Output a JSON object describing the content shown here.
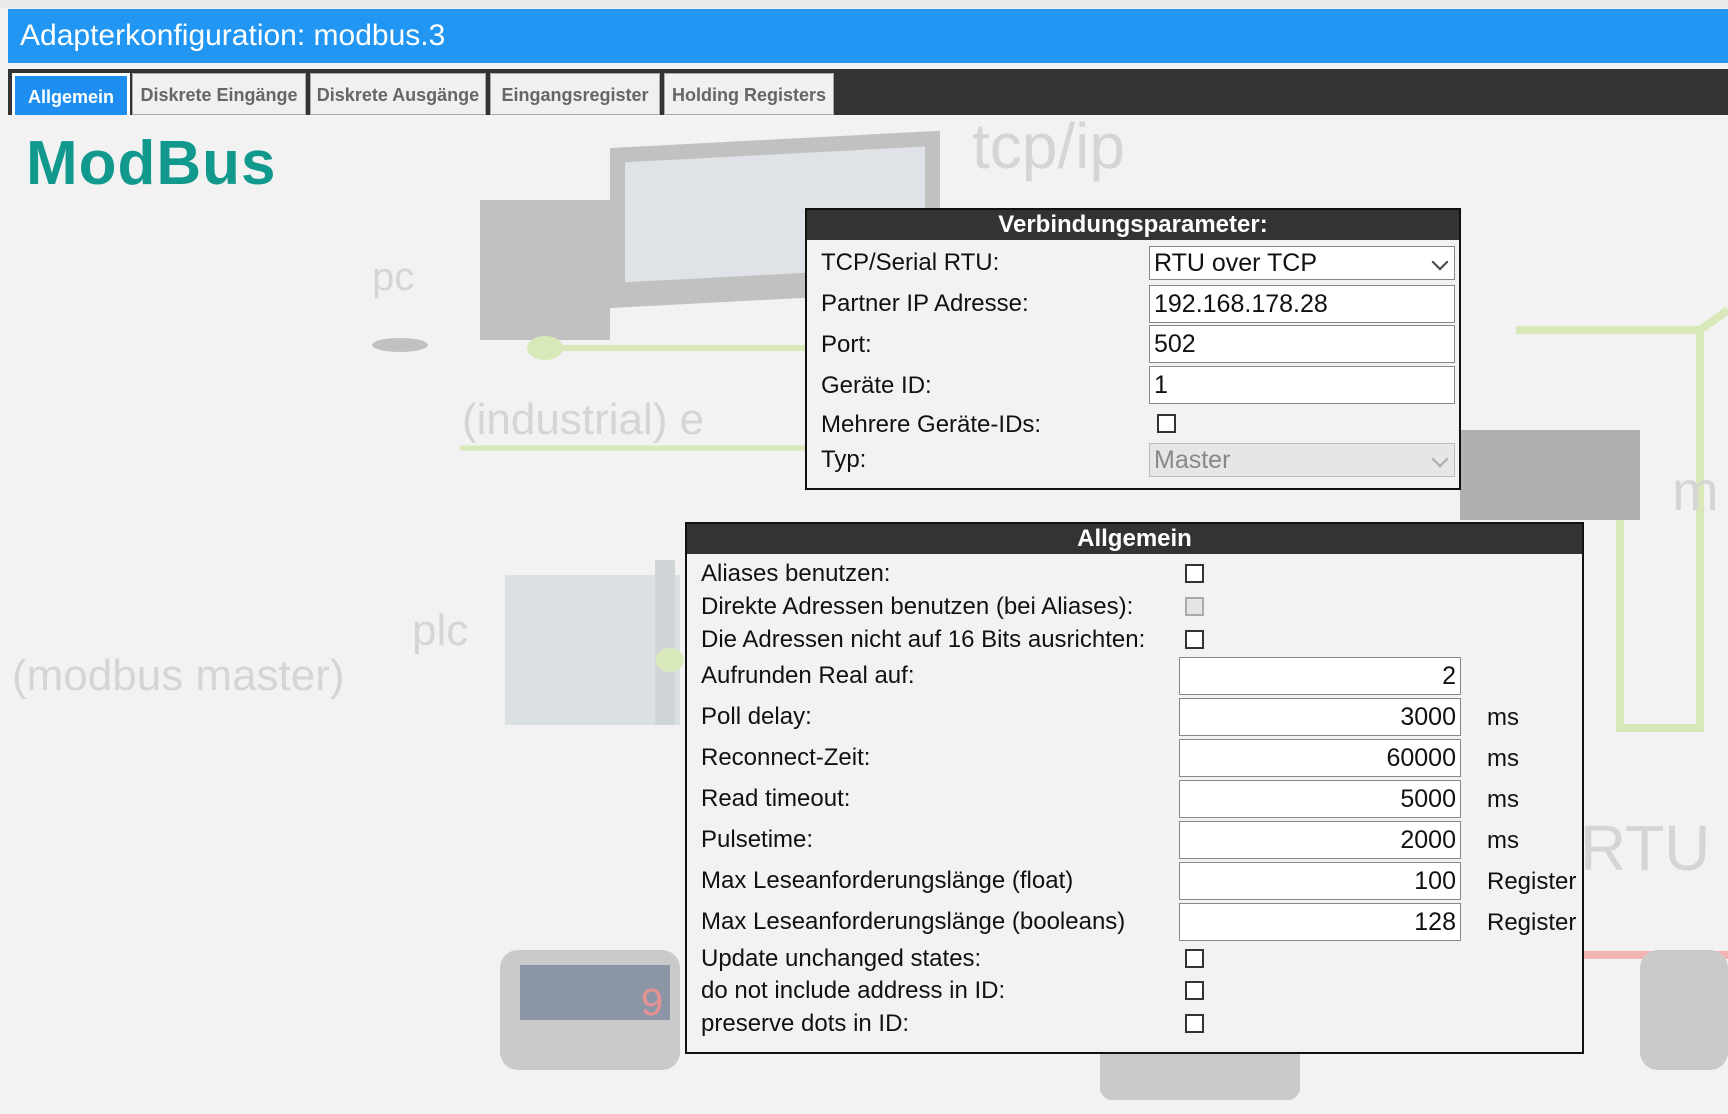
{
  "window": {
    "title": "Adapterkonfiguration: modbus.3"
  },
  "tabs": [
    {
      "label": "Allgemein",
      "active": true
    },
    {
      "label": "Diskrete Eingänge",
      "active": false
    },
    {
      "label": "Diskrete Ausgänge",
      "active": false
    },
    {
      "label": "Eingangsregister",
      "active": false
    },
    {
      "label": "Holding Registers",
      "active": false
    }
  ],
  "brand": "ModBus",
  "background": {
    "tcpip": "tcp/ip",
    "pc": "pc",
    "industrial": "(industrial) e",
    "plc": "plc",
    "modbus_master": "(modbus master)",
    "m": "m",
    "rtu": "RTU",
    "display_digit": "9",
    "colors": {
      "green": "#c5e08a",
      "red": "#f28080",
      "ghost": "#c8c8c8"
    }
  },
  "connection": {
    "title": "Verbindungsparameter:",
    "rows": [
      {
        "label": "TCP/Serial RTU:",
        "value": "RTU over TCP"
      },
      {
        "label": "Partner IP Adresse:",
        "value": "192.168.178.28"
      },
      {
        "label": "Port:",
        "value": "502"
      },
      {
        "label": "Geräte ID:",
        "value": "1"
      },
      {
        "label": "Mehrere Geräte-IDs:",
        "checked": false
      },
      {
        "label": "Typ:",
        "value": "Master",
        "disabled": true
      }
    ]
  },
  "general": {
    "title": "Allgemein",
    "rows": [
      {
        "label": "Aliases benutzen:",
        "checked": false
      },
      {
        "label": "Direkte Adressen benutzen (bei Aliases):",
        "checked": false,
        "disabled": true
      },
      {
        "label": "Die Adressen nicht auf 16 Bits ausrichten:",
        "checked": false
      },
      {
        "label": "Aufrunden Real auf:",
        "value": "2",
        "unit": ""
      },
      {
        "label": "Poll delay:",
        "value": "3000",
        "unit": "ms"
      },
      {
        "label": "Reconnect-Zeit:",
        "value": "60000",
        "unit": "ms"
      },
      {
        "label": "Read timeout:",
        "value": "5000",
        "unit": "ms"
      },
      {
        "label": "Pulsetime:",
        "value": "2000",
        "unit": "ms"
      },
      {
        "label": "Max Leseanforderungslänge (float)",
        "value": "100",
        "unit": "Register"
      },
      {
        "label": "Max Leseanforderungslänge (booleans)",
        "value": "128",
        "unit": "Register"
      },
      {
        "label": "Update unchanged states:",
        "checked": false
      },
      {
        "label": "do not include address in ID:",
        "checked": false
      },
      {
        "label": "preserve dots in ID:",
        "checked": false
      }
    ]
  },
  "colors": {
    "accent": "#2196f3",
    "tabbar": "#333333",
    "brand": "#11998e"
  }
}
